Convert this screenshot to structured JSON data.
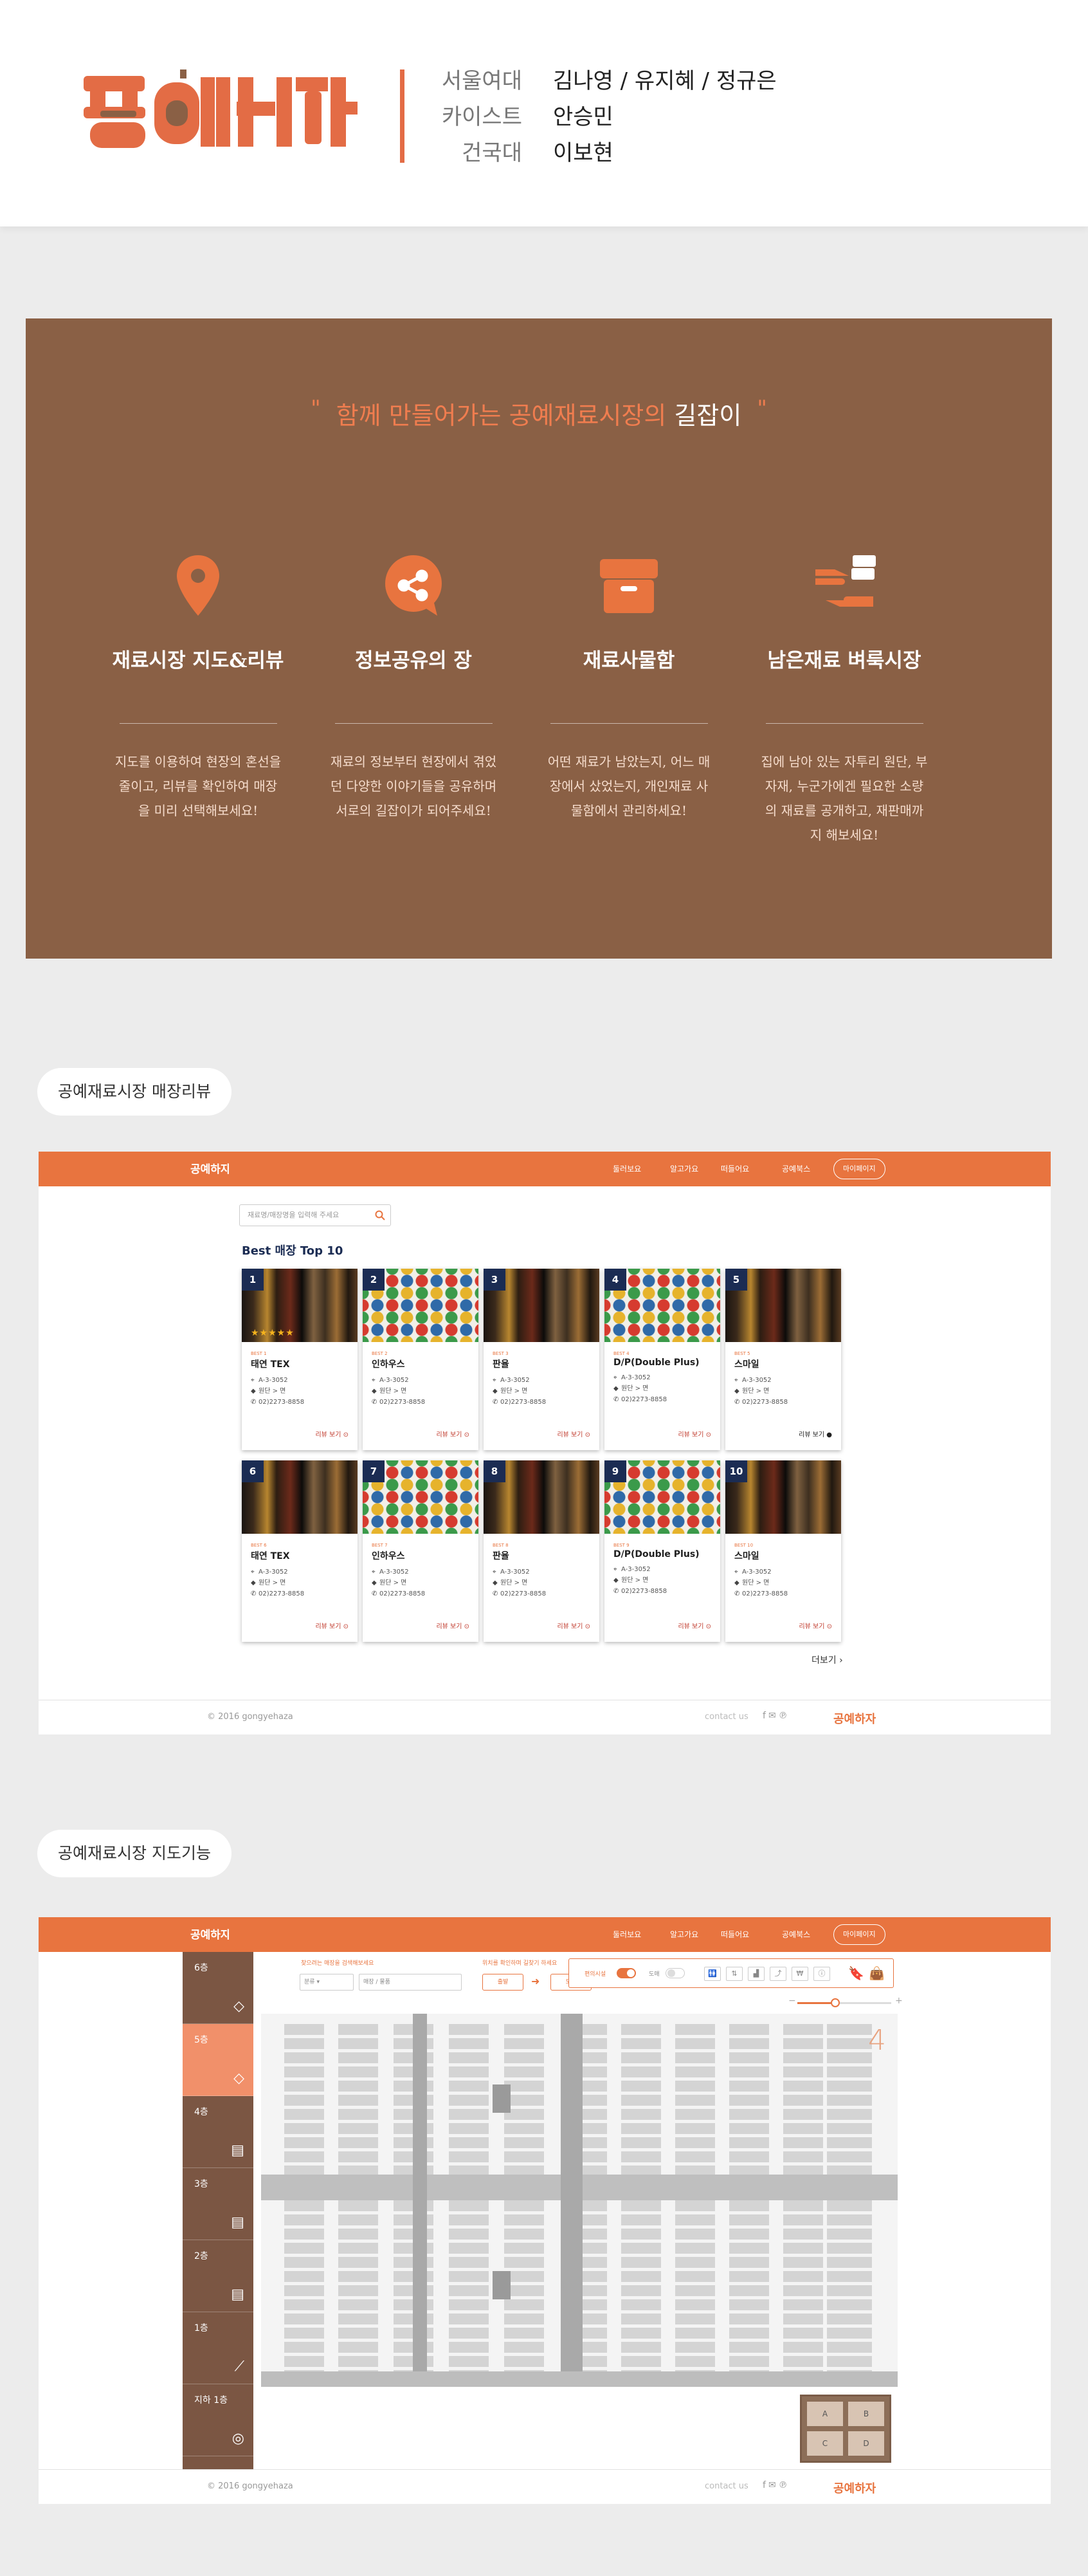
{
  "header": {
    "logo_text": "공예하자",
    "team": [
      {
        "school": "서울여대",
        "names": "김나영 / 유지혜 / 정규은"
      },
      {
        "school": "카이스트",
        "names": "안승민"
      },
      {
        "school": "건국대",
        "names": "이보현"
      }
    ]
  },
  "band": {
    "tagline_prefix": "함께 만들어가는 공예재료시장의",
    "tagline_highlight": "길잡이",
    "open_quote": "\"",
    "close_quote": "\"",
    "features": [
      {
        "icon": "map-pin-icon",
        "title": "재료시장 지도&리뷰",
        "desc": "지도를 이용하여 현장의 혼선을 줄이고, 리뷰를 확인하여 매장을 미리 선택해보세요!"
      },
      {
        "icon": "share-bubble-icon",
        "title": "정보공유의 장",
        "desc": "재료의 정보부터 현장에서 겪었던 다양한 이야기들을 공유하며 서로의 길잡이가 되어주세요!"
      },
      {
        "icon": "box-icon",
        "title": "재료사물함",
        "desc": "어떤 재료가 남았는지, 어느 매장에서 샀었는지, 개인재료 사물함에서 관리하세요!"
      },
      {
        "icon": "handover-icon",
        "title": "남은재료 벼룩시장",
        "desc": "집에 남아 있는 자투리 원단, 부자재, 누군가에겐 필요한 소량의 재료를 공개하고, 재판매까지 해보세요!"
      }
    ]
  },
  "section1": {
    "label": "공예재료시장 매장리뷰"
  },
  "section2": {
    "label": "공예재료시장 지도기능"
  },
  "nav": {
    "logo": "공예하자",
    "items": [
      "둘러보요",
      "알고가요",
      "떠들어요",
      "공예북스"
    ],
    "button": "마이페이지"
  },
  "store_review": {
    "search_placeholder": "재료명/매장명을 입력해 주세요",
    "best_title": "Best 매장 Top 10",
    "cards": [
      {
        "rank": "1",
        "sub": "BEST 1",
        "name": "태연 TEX",
        "addr": "A-3-3052",
        "cat": "원단 > 면",
        "tel": "02)2273-8858",
        "btn": "리뷰 보기",
        "img": "fabric",
        "stars": "★★★★★"
      },
      {
        "rank": "2",
        "sub": "BEST 2",
        "name": "인하우스",
        "addr": "A-3-3052",
        "cat": "원단 > 면",
        "tel": "02)2273-8858",
        "btn": "리뷰 보기",
        "img": "beads",
        "stars": ""
      },
      {
        "rank": "3",
        "sub": "BEST 3",
        "name": "판율",
        "addr": "A-3-3052",
        "cat": "원단 > 면",
        "tel": "02)2273-8858",
        "btn": "리뷰 보기",
        "img": "fabric",
        "stars": ""
      },
      {
        "rank": "4",
        "sub": "BEST 4",
        "name": "D/P(Double Plus)",
        "addr": "A-3-3052",
        "cat": "원단 > 면",
        "tel": "02)2273-8858",
        "btn": "리뷰 보기",
        "img": "beads",
        "stars": ""
      },
      {
        "rank": "5",
        "sub": "BEST 5",
        "name": "스마일",
        "addr": "A-3-3052",
        "cat": "원단 > 면",
        "tel": "02)2273-8858",
        "btn": "리뷰 보기",
        "img": "fabric",
        "stars": ""
      },
      {
        "rank": "6",
        "sub": "BEST 6",
        "name": "태연 TEX",
        "addr": "A-3-3052",
        "cat": "원단 > 면",
        "tel": "02)2273-8858",
        "btn": "리뷰 보기",
        "img": "fabric",
        "stars": ""
      },
      {
        "rank": "7",
        "sub": "BEST 7",
        "name": "인하우스",
        "addr": "A-3-3052",
        "cat": "원단 > 면",
        "tel": "02)2273-8858",
        "btn": "리뷰 보기",
        "img": "beads",
        "stars": ""
      },
      {
        "rank": "8",
        "sub": "BEST 8",
        "name": "판율",
        "addr": "A-3-3052",
        "cat": "원단 > 면",
        "tel": "02)2273-8858",
        "btn": "리뷰 보기",
        "img": "fabric",
        "stars": ""
      },
      {
        "rank": "9",
        "sub": "BEST 9",
        "name": "D/P(Double Plus)",
        "addr": "A-3-3052",
        "cat": "원단 > 면",
        "tel": "02)2273-8858",
        "btn": "리뷰 보기",
        "img": "beads",
        "stars": ""
      },
      {
        "rank": "10",
        "sub": "BEST 10",
        "name": "스마일",
        "addr": "A-3-3052",
        "cat": "원단 > 면",
        "tel": "02)2273-8858",
        "btn": "리뷰 보기",
        "img": "fabric",
        "stars": ""
      }
    ],
    "more": "더보기 ›"
  },
  "footer": {
    "copyright": "© 2016 gongyehaza",
    "contact": "contact us",
    "icons": [
      "facebook-icon",
      "mail-icon",
      "pinterest-icon"
    ]
  },
  "map_view": {
    "floors": [
      {
        "label": "6층",
        "icon": "diamond-icon"
      },
      {
        "label": "5층",
        "icon": "diamond-icon"
      },
      {
        "label": "4층",
        "icon": "page-icon"
      },
      {
        "label": "3층",
        "icon": "page-icon"
      },
      {
        "label": "2층",
        "icon": "page-icon"
      },
      {
        "label": "1층",
        "icon": "needle-icon"
      },
      {
        "label": "지하 1층",
        "icon": "thread-icon"
      }
    ],
    "active_floor": 1,
    "filter_label": "찾으려는 매장을 검색해보세요",
    "route_label": "위치를 확인하며 길찾기 하세요",
    "select_placeholder": "분류",
    "search_placeholder": "매장 / 물품",
    "route_from": "출발",
    "route_to": "도착",
    "toggle_on": "편의시설",
    "toggle_off": "도매",
    "floor_number": "4",
    "minimap_labels": [
      "A",
      "B",
      "C",
      "D"
    ],
    "zoom_minus": "−",
    "zoom_plus": "+"
  },
  "colors": {
    "brand": "#e8743f",
    "band": "#8a6045",
    "sidebar": "#7b5643",
    "navy": "#1b2c53"
  }
}
